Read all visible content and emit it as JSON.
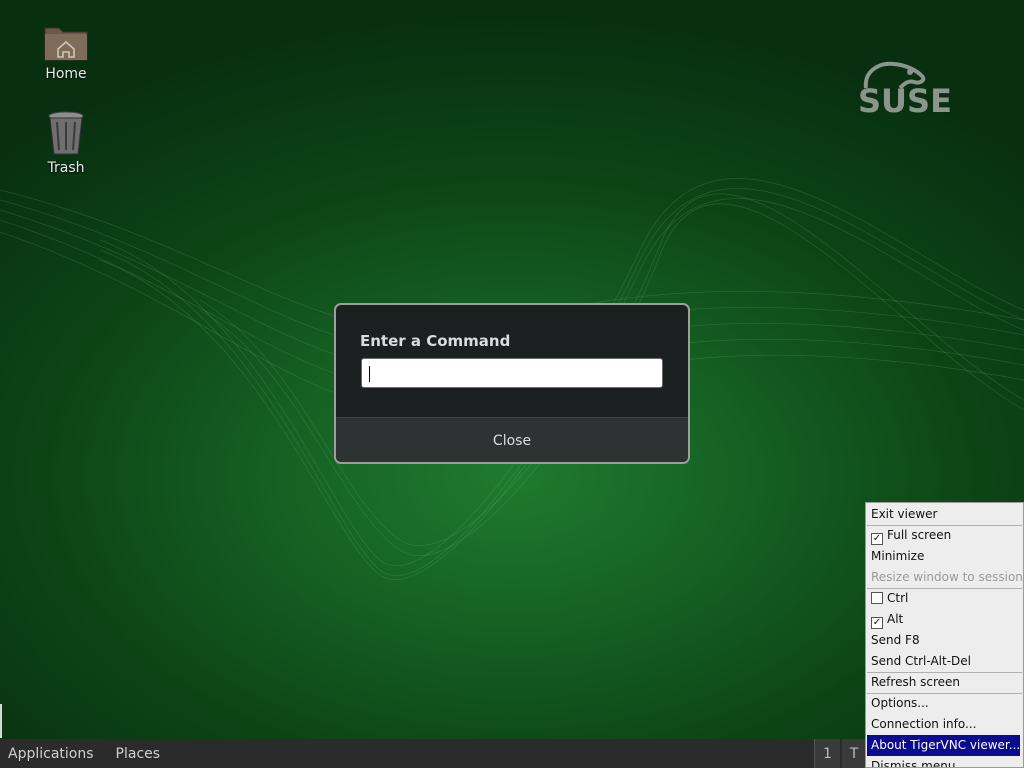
{
  "desktop": {
    "icons": [
      {
        "label": "Home",
        "icon": "home-folder-icon"
      },
      {
        "label": "Trash",
        "icon": "trash-icon"
      }
    ],
    "logo": "SUSE"
  },
  "dialog": {
    "title": "Enter a Command",
    "input_value": "",
    "close_label": "Close"
  },
  "panel": {
    "applications": "Applications",
    "places": "Places",
    "workspace": "1",
    "second": "T"
  },
  "context_menu": {
    "items": [
      {
        "label": "Exit viewer"
      },
      {
        "label": "Full screen",
        "checked": true
      },
      {
        "label": "Minimize"
      },
      {
        "label": "Resize window to session",
        "disabled": true
      },
      {
        "label": "Ctrl",
        "checked": false
      },
      {
        "label": "Alt",
        "checked": true
      },
      {
        "label": "Send F8"
      },
      {
        "label": "Send Ctrl-Alt-Del"
      },
      {
        "label": "Refresh screen"
      },
      {
        "label": "Options..."
      },
      {
        "label": "Connection info..."
      },
      {
        "label": "About TigerVNC viewer...",
        "highlighted": true
      },
      {
        "label": "Dismiss menu"
      }
    ]
  },
  "colors": {
    "menu_highlight": "#0b0b8f",
    "desktop_green": "#155f22"
  }
}
